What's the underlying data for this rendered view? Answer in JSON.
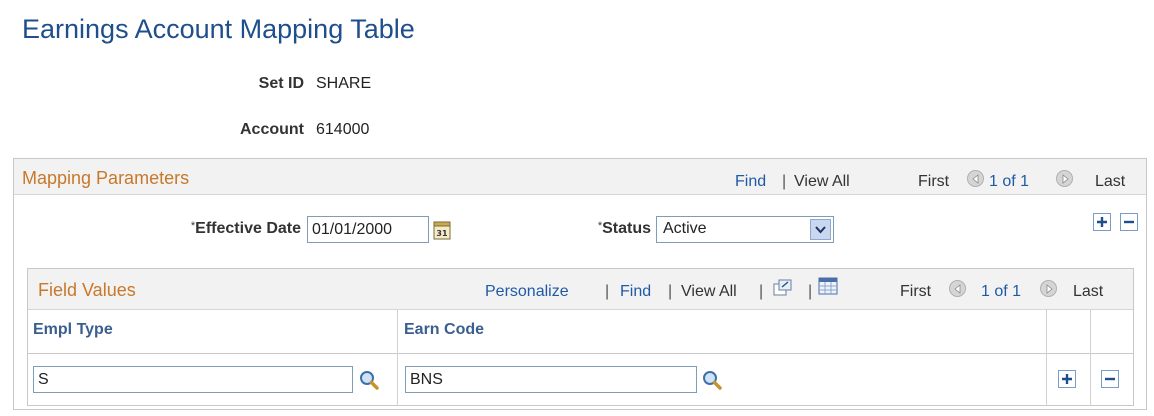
{
  "page": {
    "title": "Earnings Account Mapping Table"
  },
  "info": {
    "setid_label": "Set ID",
    "setid_value": "SHARE",
    "account_label": "Account",
    "account_value": "614000"
  },
  "mapping": {
    "title": "Mapping Parameters",
    "find": "Find",
    "sep": "|",
    "view_all": "View All",
    "first": "First",
    "count": "1 of 1",
    "last": "Last",
    "effdt_req": "*",
    "effdt_label": "Effective Date",
    "effdt_value": "01/01/2000",
    "status_req": "*",
    "status_label": "Status",
    "status_value": "Active"
  },
  "field_values": {
    "title": "Field Values",
    "personalize": "Personalize",
    "sep": "|",
    "find": "Find",
    "view_all": "View All",
    "first": "First",
    "count": "1 of 1",
    "last": "Last",
    "columns": [
      "Empl Type",
      "Earn Code"
    ],
    "rows": [
      {
        "empl_type": "S",
        "earn_code": "BNS"
      }
    ]
  },
  "colors": {
    "title": "#1f4e8c",
    "section_title": "#c8782a",
    "link": "#1f5aa6",
    "grid_header": "#3a5f8f"
  }
}
